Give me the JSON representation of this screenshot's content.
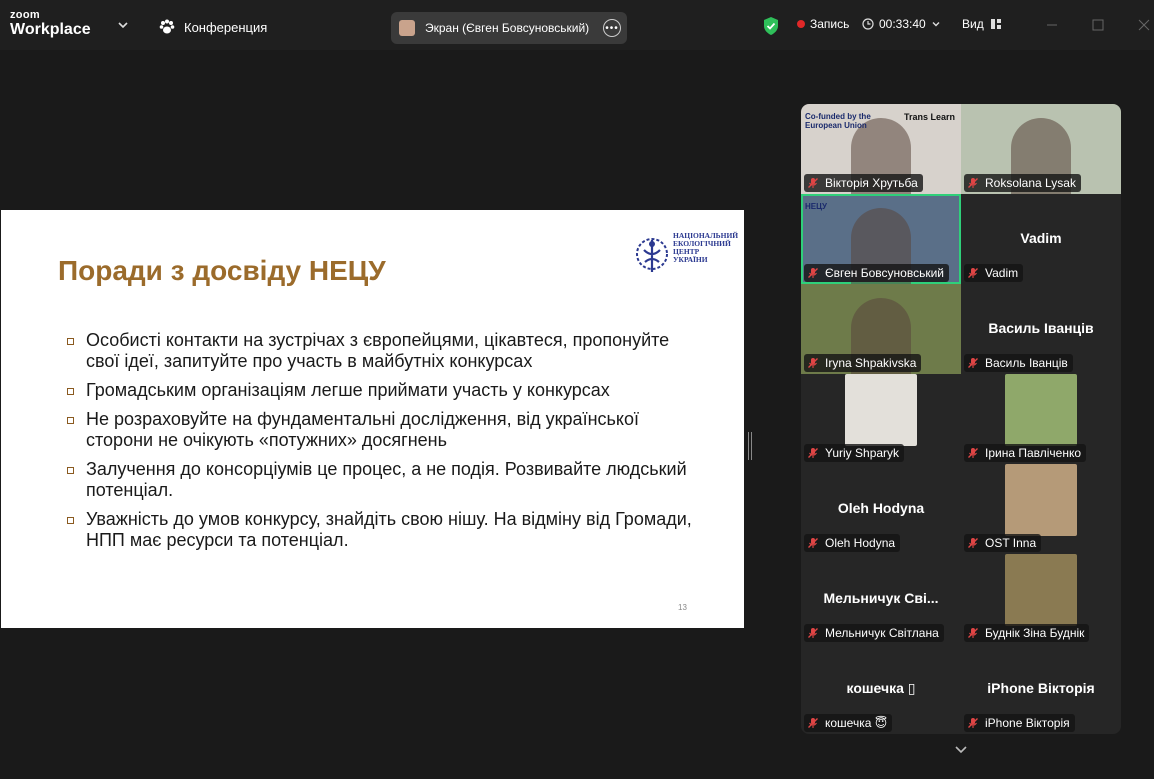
{
  "titlebar": {
    "logo_small": "zoom",
    "logo_big": "Workplace",
    "meeting_label": "Конференция",
    "screen_share_label": "Экран (Євген Бовсуновський)",
    "recording_label": "Запись",
    "timer": "00:33:40",
    "view_label": "Вид"
  },
  "slide": {
    "title": "Поради з досвіду НЕЦУ",
    "logo_text": "НАЦІОНАЛЬНИЙ ЕКОЛОГІЧНИЙ ЦЕНТР УКРАЇНИ",
    "bullets": [
      "Особисті контакти на зустрічах з європейцями, цікавтеся, пропонуйте свої ідеї, запитуйте про участь в майбутніх конкурсах",
      "Громадським організаціям легше приймати участь у конкурсах",
      "Не розраховуйте на фундаментальні дослідження, від української сторони не очікують «потужних» досягнень",
      "Залучення до консорціумів це процес, а не подія. Розвивайте людський потенціал.",
      "Уважність до умов конкурсу, знайдіть свою нішу. На відміну від Громади, НПП має ресурси та потенціал."
    ],
    "page_number": "13"
  },
  "participants": [
    {
      "label": "Вікторія Хрутьба",
      "big": "",
      "video": true,
      "bg": "#d7d2cc",
      "banner_left": "Co-funded by the European Union",
      "banner_right": "Trans Learn"
    },
    {
      "label": "Roksolana Lysak",
      "big": "",
      "video": true,
      "bg": "#b9c2b0"
    },
    {
      "label": "Євген Бовсуновський",
      "big": "",
      "video": true,
      "bg": "#5a6f88",
      "active": true,
      "banner_left": "НЕЦУ"
    },
    {
      "label": "Vadim",
      "big": "Vadim",
      "video": false
    },
    {
      "label": "Iryna Shpakivska",
      "big": "",
      "video": true,
      "bg": "#6e7b4a"
    },
    {
      "label": "Василь Іванців",
      "big": "Василь Іванців",
      "video": false
    },
    {
      "label": "Yuriy Shparyk",
      "big": "",
      "video": true,
      "bg": "#e3e0da",
      "photo": true
    },
    {
      "label": "Ірина Павліченко",
      "big": "",
      "video": true,
      "bg": "#8fa86a",
      "photo": true
    },
    {
      "label": "Oleh Hodyna",
      "big": "Oleh Hodyna",
      "video": false
    },
    {
      "label": "OST Inna",
      "big": "",
      "video": true,
      "bg": "#b59a78",
      "photo": true
    },
    {
      "label": "Мельничук Світлана",
      "big": "Мельничук Сві...",
      "video": false
    },
    {
      "label": "Буднік Зіна Буднік",
      "big": "",
      "video": true,
      "bg": "#8a7a52",
      "photo": true
    },
    {
      "label": "кошечка 😇",
      "big": "кошечка ▯",
      "video": false
    },
    {
      "label": "iPhone Вікторія",
      "big": "iPhone Вікторія",
      "video": false
    }
  ],
  "colors": {
    "slide_title": "#9b6b2b",
    "active_speaker": "#2fd07a",
    "recording_dot": "#e02828",
    "mic_muted": "#e04545",
    "shield": "#2fbf5a"
  }
}
